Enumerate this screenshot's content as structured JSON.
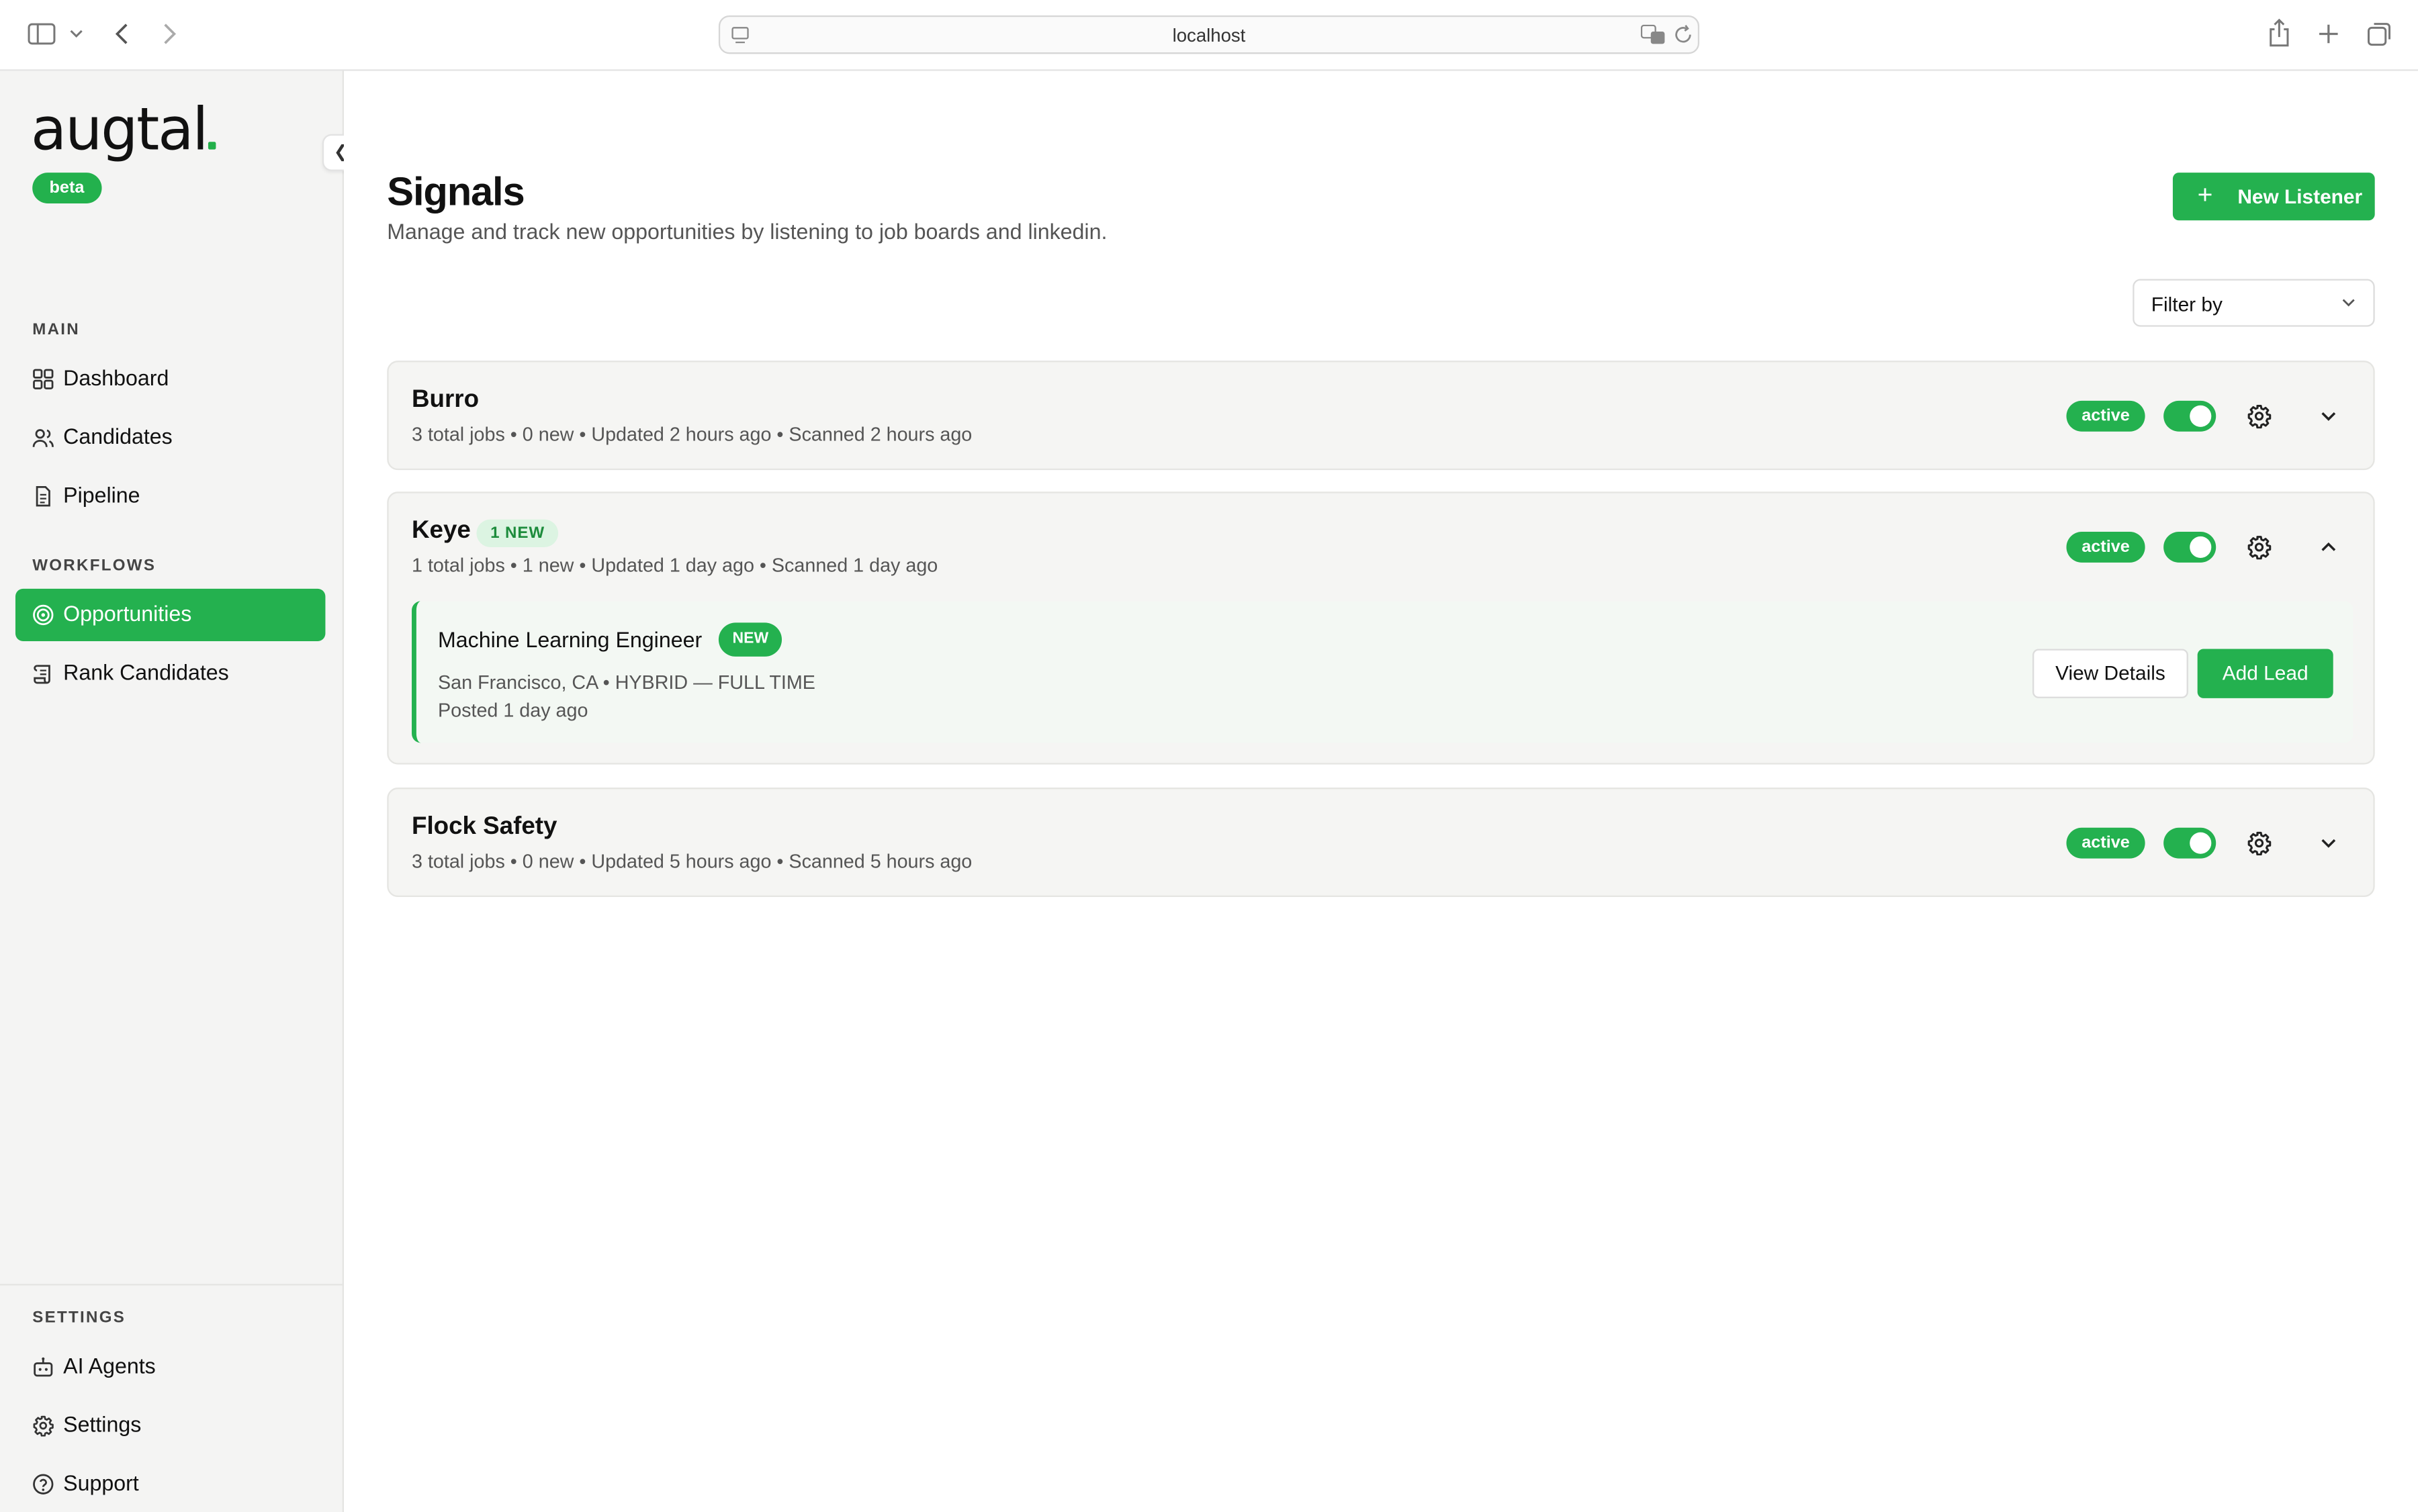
{
  "browser": {
    "url": "localhost"
  },
  "sidebar": {
    "logo": "augtal",
    "badge": "beta",
    "sections": {
      "main": "MAIN",
      "workflows": "WORKFLOWS",
      "settings": "SETTINGS"
    },
    "items": {
      "dashboard": "Dashboard",
      "candidates": "Candidates",
      "pipeline": "Pipeline",
      "opportunities": "Opportunities",
      "rank_candidates": "Rank Candidates",
      "ai_agents": "AI Agents",
      "settings": "Settings",
      "support": "Support"
    }
  },
  "main": {
    "title": "Signals",
    "subtitle": "Manage and track new opportunities by listening to job boards and linkedin.",
    "new_listener": "New Listener",
    "filter_label": "Filter by",
    "cards": [
      {
        "name": "Burro",
        "meta": "3 total jobs • 0 new • Updated 2 hours ago • Scanned 2 hours ago",
        "status": "active",
        "enabled": true
      },
      {
        "name": "Keye",
        "new_badge": "1 NEW",
        "meta": "1 total jobs • 1 new • Updated 1 day ago • Scanned 1 day ago",
        "status": "active",
        "enabled": true,
        "job": {
          "title": "Machine Learning Engineer",
          "badge": "NEW",
          "location": "San Francisco, CA • HYBRID — FULL TIME",
          "posted": "Posted 1 day ago",
          "view_details": "View Details",
          "add_lead": "Add Lead"
        }
      },
      {
        "name": "Flock Safety",
        "meta": "3 total jobs • 0 new • Updated 5 hours ago • Scanned 5 hours ago",
        "status": "active",
        "enabled": true
      }
    ]
  },
  "colors": {
    "accent": "#24b14f",
    "sidebar_bg": "#f4f4f3",
    "card_bg": "#f5f5f3"
  }
}
